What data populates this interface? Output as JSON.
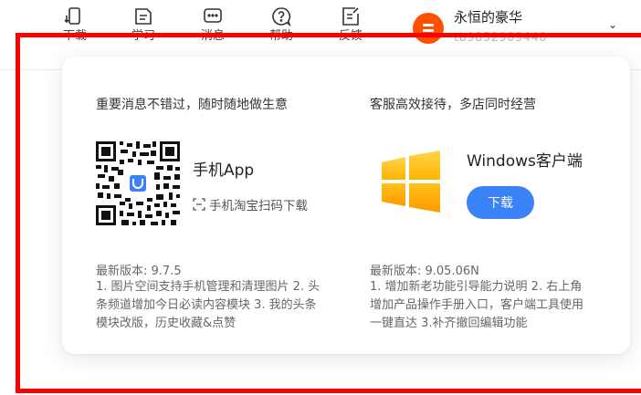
{
  "toolbar": {
    "items": [
      {
        "label": "下载",
        "icon": "phone-download-icon"
      },
      {
        "label": "学习",
        "icon": "study-icon"
      },
      {
        "label": "消息",
        "icon": "message-icon"
      },
      {
        "label": "帮助",
        "icon": "help-icon"
      },
      {
        "label": "反馈",
        "icon": "feedback-icon"
      }
    ]
  },
  "user": {
    "name": "永恒的豪华",
    "uid": "tb9852909440"
  },
  "popover": {
    "mobile": {
      "heading": "重要消息不错过，随时随地做生意",
      "app_name": "手机App",
      "scan_hint": "手机淘宝扫码下载",
      "version": "最新版本: 9.7.5",
      "notes": "1. 图片空间支持手机管理和清理图片 2. 头条频道增加今日必读内容模块 3. 我的头条模块改版，历史收藏&点赞"
    },
    "desktop": {
      "heading": "客服高效接待，多店同时经营",
      "client_name": "Windows客户端",
      "download_label": "下载",
      "version": "最新版本: 9.05.06N",
      "notes": "1. 增加新老功能引导能力说明 2. 右上角增加产品操作手册入口，客户端工具使用一键直达 3.补齐撤回编辑功能"
    }
  },
  "colors": {
    "accent_blue": "#3b82f6",
    "brand_orange": "#ff5000",
    "highlight_red": "#ff0000",
    "windows_yellow": "#ffb000"
  }
}
